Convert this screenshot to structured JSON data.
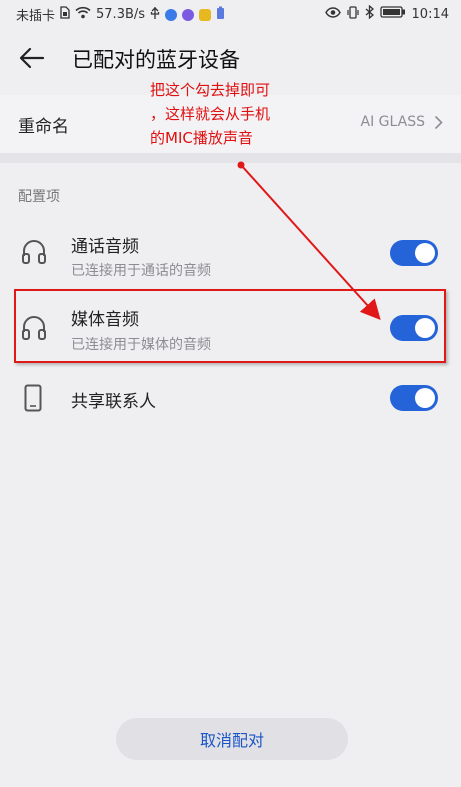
{
  "status_bar": {
    "carrier": "未插卡",
    "speed": "57.3B/s",
    "time": "10:14",
    "left_icons": [
      "sim-icon",
      "wifi-icon",
      "usb-icon",
      "app-icon-blue",
      "app-icon-purple",
      "app-icon-yellow",
      "battery-saver-icon"
    ],
    "right_icons": [
      "eye-icon",
      "vibrate-icon",
      "bluetooth-icon",
      "battery-icon"
    ]
  },
  "header": {
    "back_icon": "arrow-left-icon",
    "title": "已配对的蓝牙设备"
  },
  "rename": {
    "label": "重命名",
    "value": "AI GLASS",
    "chevron_icon": "chevron-right-icon"
  },
  "section": {
    "label": "配置项"
  },
  "options": [
    {
      "title": "通话音频",
      "subtitle": "已连接用于通话的音频",
      "icon": "headphones-icon",
      "enabled": true
    },
    {
      "title": "媒体音频",
      "subtitle": "已连接用于媒体的音频",
      "icon": "headphones-icon",
      "enabled": true
    },
    {
      "title": "共享联系人",
      "subtitle": "",
      "icon": "phone-icon",
      "enabled": true
    }
  ],
  "annotation": {
    "lines": [
      "把这个勾去掉即可",
      "，这样就会从手机",
      "的MIC播放声音"
    ]
  },
  "footer": {
    "unpair_label": "取消配对"
  },
  "colors": {
    "accent": "#2563d8",
    "annotation_red": "#e01818",
    "button_text": "#1a55c9",
    "background": "#efeef1"
  }
}
